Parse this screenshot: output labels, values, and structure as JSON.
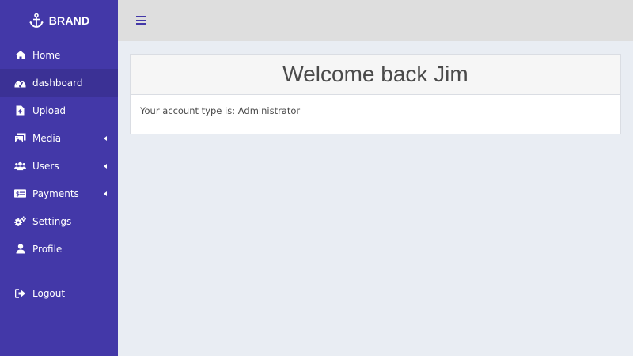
{
  "brand": {
    "name": "BRAND",
    "icon": "anchor-icon"
  },
  "sidebar": {
    "items": [
      {
        "label": "Home",
        "icon": "home-icon",
        "active": false,
        "has_caret": false
      },
      {
        "label": "dashboard",
        "icon": "tachometer-icon",
        "active": true,
        "has_caret": false
      },
      {
        "label": "Upload",
        "icon": "file-upload-icon",
        "active": false,
        "has_caret": false
      },
      {
        "label": "Media",
        "icon": "images-icon",
        "active": false,
        "has_caret": true
      },
      {
        "label": "Users",
        "icon": "users-icon",
        "active": false,
        "has_caret": true
      },
      {
        "label": "Payments",
        "icon": "money-bill-icon",
        "active": false,
        "has_caret": true
      },
      {
        "label": "Settings",
        "icon": "cogs-icon",
        "active": false,
        "has_caret": false
      },
      {
        "label": "Profile",
        "icon": "user-icon",
        "active": false,
        "has_caret": false
      }
    ],
    "logout": {
      "label": "Logout",
      "icon": "sign-out-icon"
    }
  },
  "topbar": {
    "menu_icon": "hamburger-icon"
  },
  "card": {
    "title": "Welcome back Jim",
    "body": "Your account type is: Administrator"
  },
  "colors": {
    "sidebar": "#4338a8",
    "sidebar_active": "#3b3195",
    "topbar": "#dedede",
    "content_bg": "#e9edf3"
  }
}
